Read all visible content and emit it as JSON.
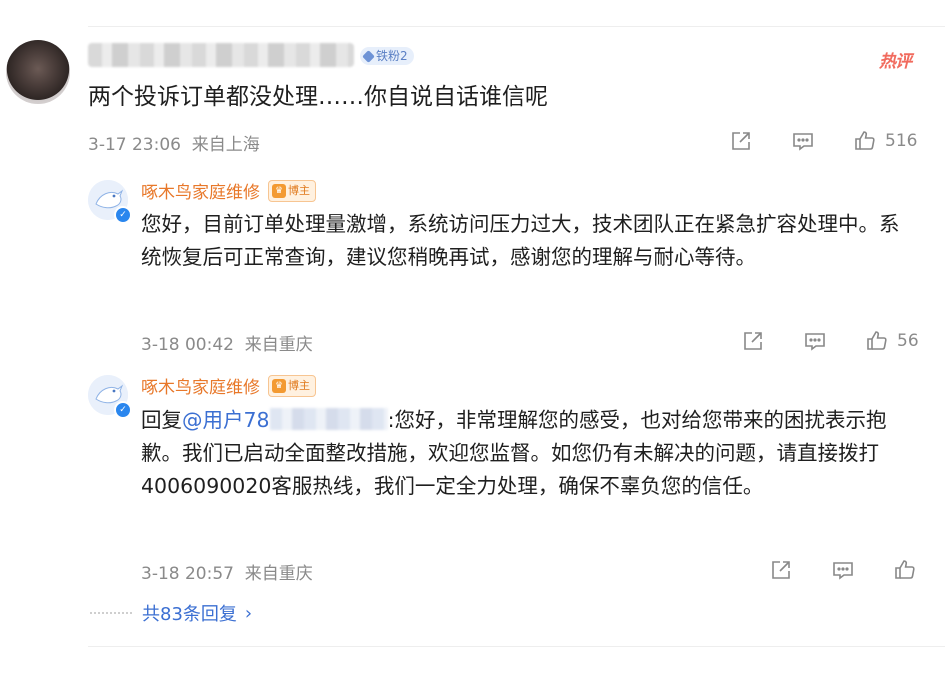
{
  "main_comment": {
    "badge": "铁粉2",
    "hot_tag": "热评",
    "text": "两个投诉订单都没处理……你自说自话谁信呢",
    "timestamp": "3-17 23:06",
    "location": "来自上海",
    "like_count": "516"
  },
  "replies": [
    {
      "author": "啄木鸟家庭维修",
      "badge": "博主",
      "text": "您好，目前订单处理量激增，系统访问压力过大，技术团队正在紧急扩容处理中。系统恢复后可正常查询，建议您稍晚再试，感谢您的理解与耐心等待。",
      "timestamp": "3-18 00:42",
      "location": "来自重庆",
      "like_count": "56"
    },
    {
      "author": "啄木鸟家庭维修",
      "badge": "博主",
      "reply_prefix": "回复",
      "mention": "@用户78",
      "text": ":您好，非常理解您的感受，也对给您带来的困扰表示抱歉。我们已启动全面整改措施，欢迎您监督。如您仍有未解决的问题，请直接拨打4006090020客服热线，我们一定全力处理，确保不辜负您的信任。",
      "timestamp": "3-18 20:57",
      "location": "来自重庆",
      "like_count": ""
    }
  ],
  "more_replies": {
    "label": "共83条回复"
  },
  "colors": {
    "accent_blue": "#3b6fd2",
    "author_orange": "#e8782a",
    "hot_red": "#f16b5e"
  },
  "icons": {
    "share": "share-icon",
    "comment": "comment-icon",
    "like": "like-icon"
  }
}
